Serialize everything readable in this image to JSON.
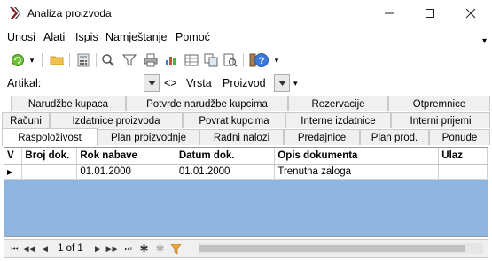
{
  "window": {
    "title": "Analiza proizvoda",
    "minimize": "—",
    "maximize": "☐",
    "close": "✕"
  },
  "menu": [
    {
      "label": "Unosi",
      "underline": "U",
      "rest": "nosi"
    },
    {
      "label": "Alati",
      "underline": "",
      "rest": "Alati"
    },
    {
      "label": "Ispis",
      "underline": "I",
      "rest": "spis"
    },
    {
      "label": "Namještanje",
      "underline": "N",
      "rest": "amještanje"
    },
    {
      "label": "Pomoć",
      "underline": "",
      "rest": "Pomoć"
    }
  ],
  "filter": {
    "artikal_label": "Artikal:",
    "artikal_value": "",
    "compare": "<>",
    "vrsta_label": "Vrsta",
    "vrsta_value": "Proizvod"
  },
  "tabs": {
    "row1": [
      "Narudžbe kupaca",
      "Potvrde narudžbe kupcima",
      "Rezervacije",
      "Otpremnice"
    ],
    "row2": [
      "Računi",
      "Izdatnice proizvoda",
      "Povrat kupcima",
      "Interne izdatnice",
      "Interni prijemi"
    ],
    "row3": [
      "Raspoloživost",
      "Plan proizvodnje",
      "Radni nalozi",
      "Predajnice",
      "Plan prod.",
      "Ponude"
    ],
    "active": "Raspoloživost"
  },
  "grid": {
    "columns": [
      "V",
      "Broj dok.",
      "Rok nabave",
      "Datum dok.",
      "Opis dokumenta",
      "Ulaz"
    ],
    "rows": [
      [
        "",
        "",
        "01.01.2000",
        "01.01.2000",
        "Trenutna zaloga",
        ""
      ]
    ]
  },
  "navigator": {
    "record_text": "1 of 1"
  }
}
